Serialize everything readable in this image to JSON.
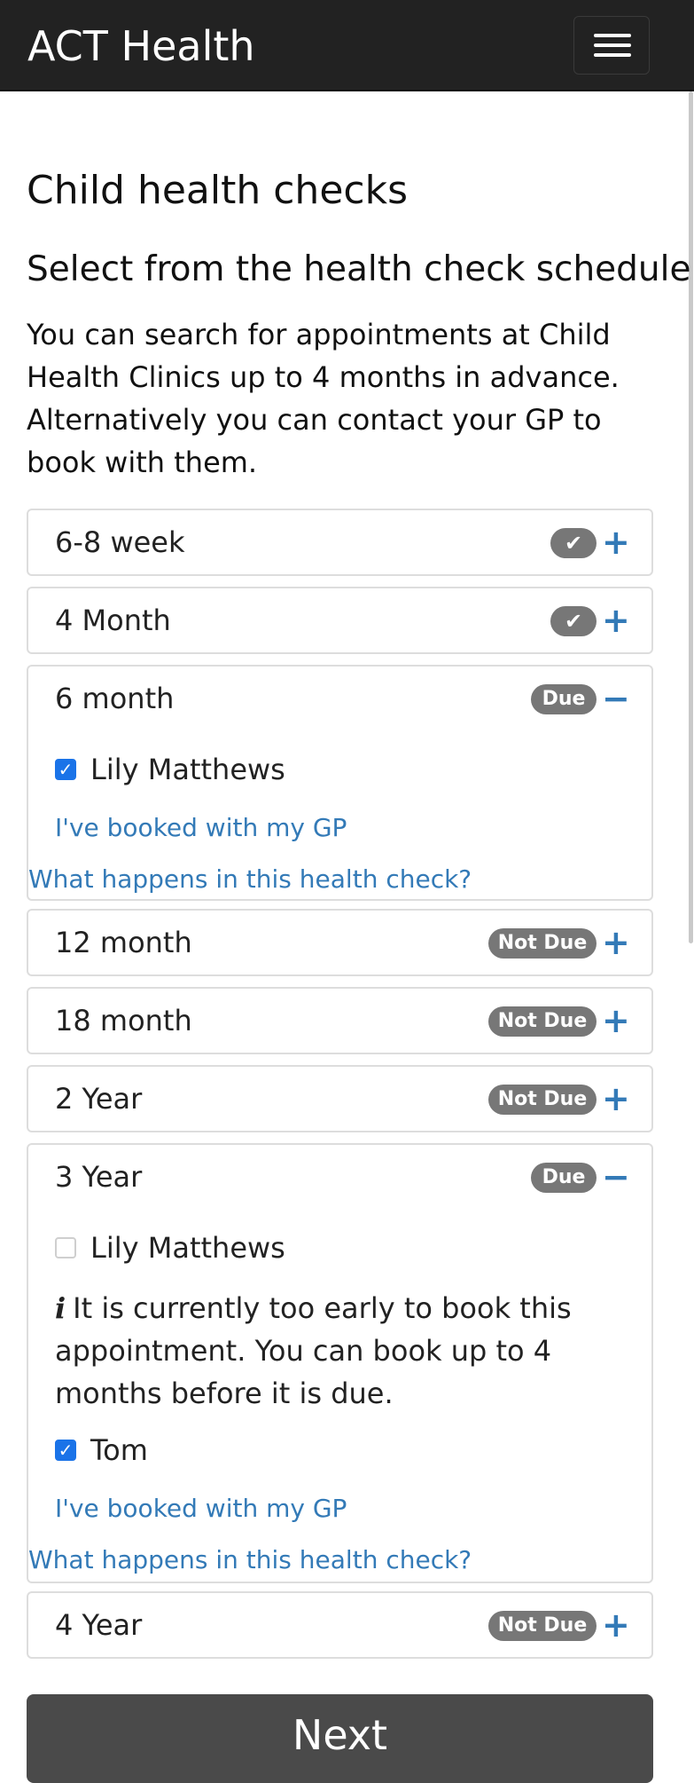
{
  "app": {
    "title": "ACT Health"
  },
  "page": {
    "heading": "Child health checks",
    "subheading": "Select from the health check schedule",
    "intro": "You can search for appointments at Child Health Clinics up to 4 months in advance. Alternatively you can contact your GP to book with them."
  },
  "icons": {
    "menu": "hamburger-icon",
    "expand": "+",
    "collapse": "−",
    "check": "✔",
    "info": "i",
    "checked_box": "✓"
  },
  "colors": {
    "navbar": "#222222",
    "link": "#337ab7",
    "badge": "#777777",
    "checkbox": "#1a73e8",
    "next_button": "#4a4a4a"
  },
  "schedule": [
    {
      "label": "6-8 week",
      "status": "completed",
      "badge": "✔",
      "expanded": false
    },
    {
      "label": "4 Month",
      "status": "completed",
      "badge": "✔",
      "expanded": false
    },
    {
      "label": "6 month",
      "status": "due",
      "badge": "Due",
      "expanded": true,
      "children": [
        {
          "name": "Lily Matthews",
          "checked": true
        }
      ],
      "gp_link": "I've booked with my GP",
      "info_link": "What happens in this health check?"
    },
    {
      "label": "12 month",
      "status": "not-due",
      "badge": "Not Due",
      "expanded": false
    },
    {
      "label": "18 month",
      "status": "not-due",
      "badge": "Not Due",
      "expanded": false
    },
    {
      "label": "2 Year",
      "status": "not-due",
      "badge": "Not Due",
      "expanded": false
    },
    {
      "label": "3 Year",
      "status": "due",
      "badge": "Due",
      "expanded": true,
      "children": [
        {
          "name": "Lily Matthews",
          "checked": false
        },
        {
          "name": "Tom",
          "checked": true
        }
      ],
      "notice": "It is currently too early to book this appointment. You can book up to 4 months before it is due.",
      "gp_link": "I've booked with my GP",
      "info_link": "What happens in this health check?"
    },
    {
      "label": "4 Year",
      "status": "not-due",
      "badge": "Not Due",
      "expanded": false
    }
  ],
  "footer": {
    "next_label": "Next"
  }
}
